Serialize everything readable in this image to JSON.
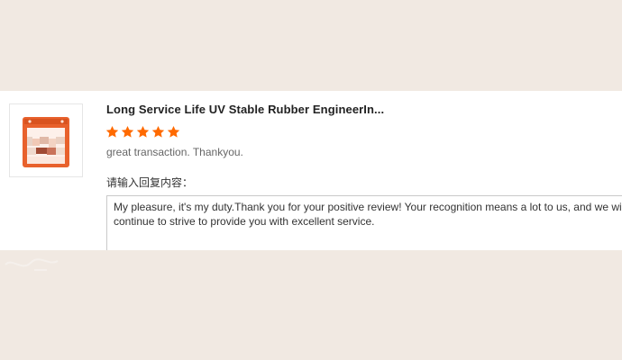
{
  "product": {
    "image_icon": "product-thumbnail",
    "title": "Long Service Life UV Stable Rubber EngineerIn..."
  },
  "rating": {
    "stars": 5,
    "max": 5,
    "star_color": "#ff6a00"
  },
  "review": {
    "text": "great transaction. Thankyou."
  },
  "reply": {
    "label": "请输入回复内容：",
    "text": "My pleasure, it's my duty.Thank you for your positive review! Your recognition means a lot to us, and we will continue to strive to provide you with excellent service."
  },
  "colors": {
    "background": "#f1e9e2",
    "panel": "#ffffff",
    "accent": "#ff6a00",
    "product_orange": "#e8612c"
  }
}
